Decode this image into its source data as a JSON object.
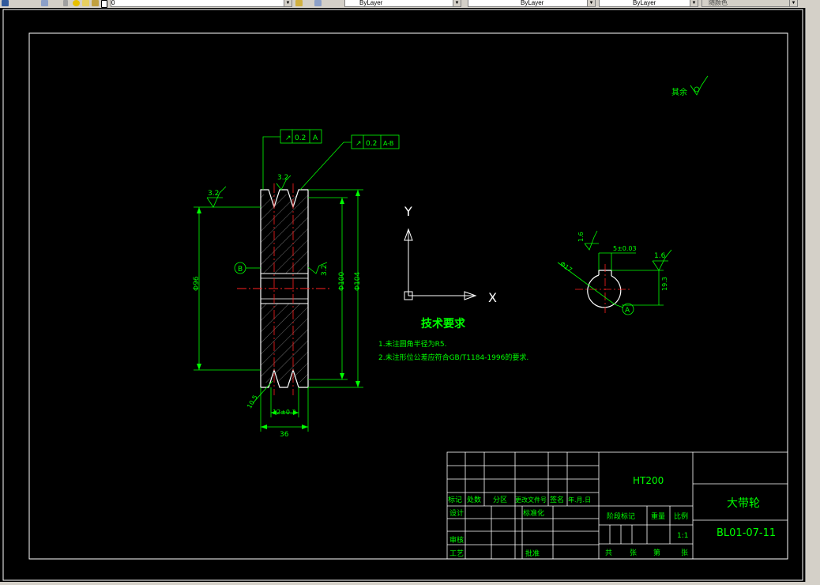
{
  "toolbar": {
    "layer_value": "0",
    "color_value": "ByLayer",
    "linetype_value": "ByLayer",
    "lineweight_value": "ByLayer",
    "plotstyle_value": "随颜色"
  },
  "drawing": {
    "tech_req_title": "技术要求",
    "tech_req_1": "1.未注圆角半径为R5.",
    "tech_req_2": "2.未注形位公差应符合GB/T1184-1996的要求.",
    "roughness_other": "其余",
    "tol_frame_1_value": "0.2",
    "tol_frame_1_datum": "A",
    "tol_frame_2_value": "0.2",
    "tol_frame_2_datum": "A-B",
    "roughness_top": "3.2",
    "roughness_left": "3.2",
    "roughness_bore": "3.2",
    "roughness_key_1": "1.6",
    "roughness_key_2": "1.6",
    "datum_b": "B",
    "datum_a": "A",
    "dim_d96": "Φ96",
    "dim_d100": "Φ100",
    "dim_d104": "Φ104",
    "dim_width": "36",
    "dim_groove": "12±0.3",
    "dim_bottom": "10.5",
    "dim_key_width": "5±0.03",
    "dim_key_depth": "19.3",
    "dim_bore": "Φ17",
    "axis_y": "Y",
    "axis_x": "X"
  },
  "title_block": {
    "material": "HT200",
    "part_name": "大带轮",
    "drawing_number": "BL01-07-11",
    "scale": "1:1",
    "label_mark": "标记",
    "label_count": "处数",
    "label_zone": "分区",
    "label_change_doc": "更改文件号",
    "label_sign": "签名",
    "label_date": "年.月.日",
    "label_design": "设计",
    "label_standardize": "标准化",
    "label_review": "审核",
    "label_process": "工艺",
    "label_approve": "批准",
    "label_stage_mark": "阶段标记",
    "label_weight": "重量",
    "label_ratio": "比例",
    "label_total": "共",
    "label_sheets": "张",
    "label_number": "第",
    "label_sheet": "张"
  }
}
